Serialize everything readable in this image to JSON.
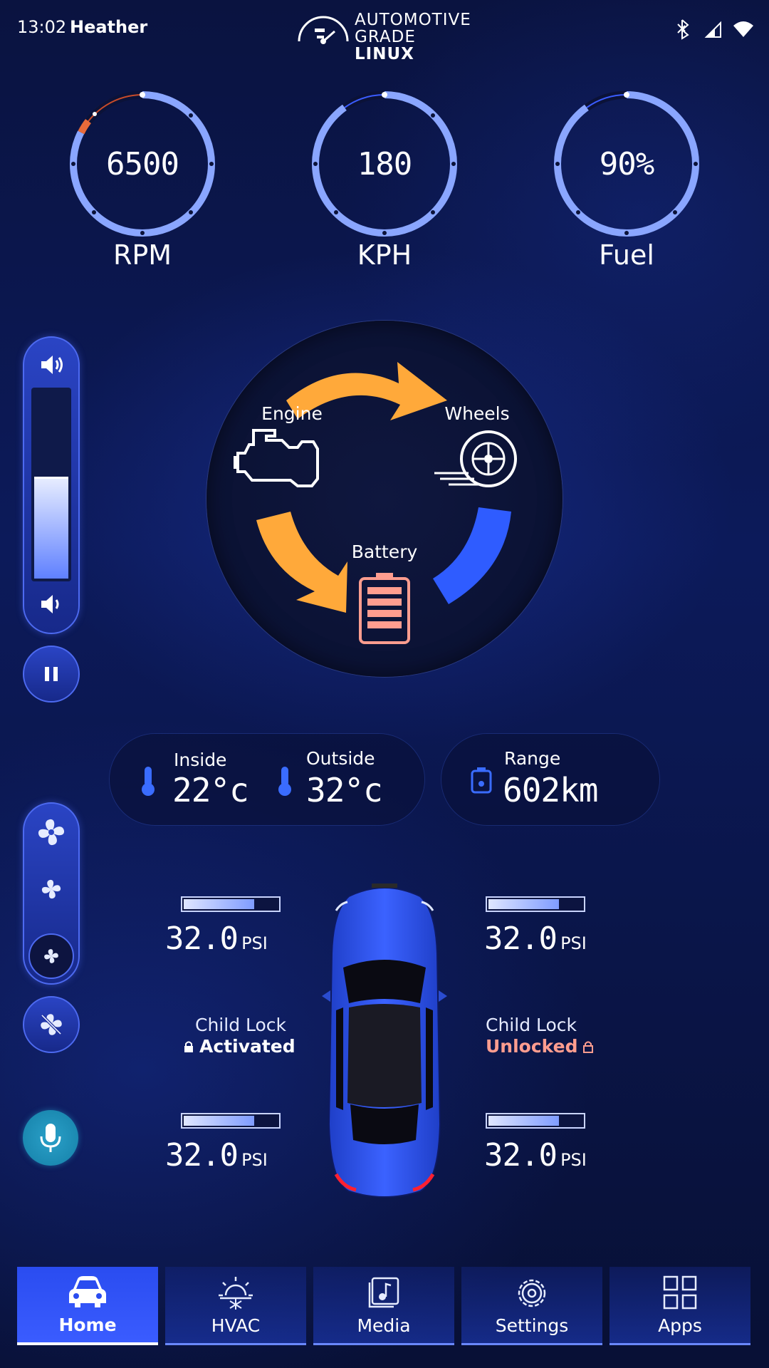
{
  "status": {
    "time": "13:02",
    "user": "Heather",
    "logo_line1": "AUTOMOTIVE",
    "logo_line2_a": "GRADE ",
    "logo_line2_b": "LINUX"
  },
  "gauges": [
    {
      "value": "6500",
      "label": "RPM",
      "level": 1.0
    },
    {
      "value": "180",
      "label": "KPH",
      "level": 1.0
    },
    {
      "value": "90%",
      "label": "Fuel",
      "level": 0.9
    }
  ],
  "volume": {
    "level": 0.53
  },
  "energy_flow": {
    "engine": "Engine",
    "wheels": "Wheels",
    "battery": "Battery"
  },
  "climate": {
    "inside_label": "Inside",
    "inside_value": "22°c",
    "outside_label": "Outside",
    "outside_value": "32°c"
  },
  "range": {
    "label": "Range",
    "value": "602km"
  },
  "tires": {
    "front_left": {
      "value": "32.0",
      "unit": "PSI",
      "level": 0.75
    },
    "front_right": {
      "value": "32.0",
      "unit": "PSI",
      "level": 0.75
    },
    "rear_left": {
      "value": "32.0",
      "unit": "PSI",
      "level": 0.75
    },
    "rear_right": {
      "value": "32.0",
      "unit": "PSI",
      "level": 0.75
    }
  },
  "child_lock": {
    "left": {
      "label": "Child Lock",
      "status": "Activated"
    },
    "right": {
      "label": "Child Lock",
      "status": "Unlocked"
    }
  },
  "nav": [
    {
      "label": "Home",
      "icon": "car-icon"
    },
    {
      "label": "HVAC",
      "icon": "hvac-icon"
    },
    {
      "label": "Media",
      "icon": "media-icon"
    },
    {
      "label": "Settings",
      "icon": "gear-icon"
    },
    {
      "label": "Apps",
      "icon": "apps-grid-icon"
    }
  ],
  "colors": {
    "accent": "#3a5cff",
    "orange": "#ffa93a",
    "unlocked": "#ff9d8f",
    "gauge_ring": "#8aa6ff"
  }
}
